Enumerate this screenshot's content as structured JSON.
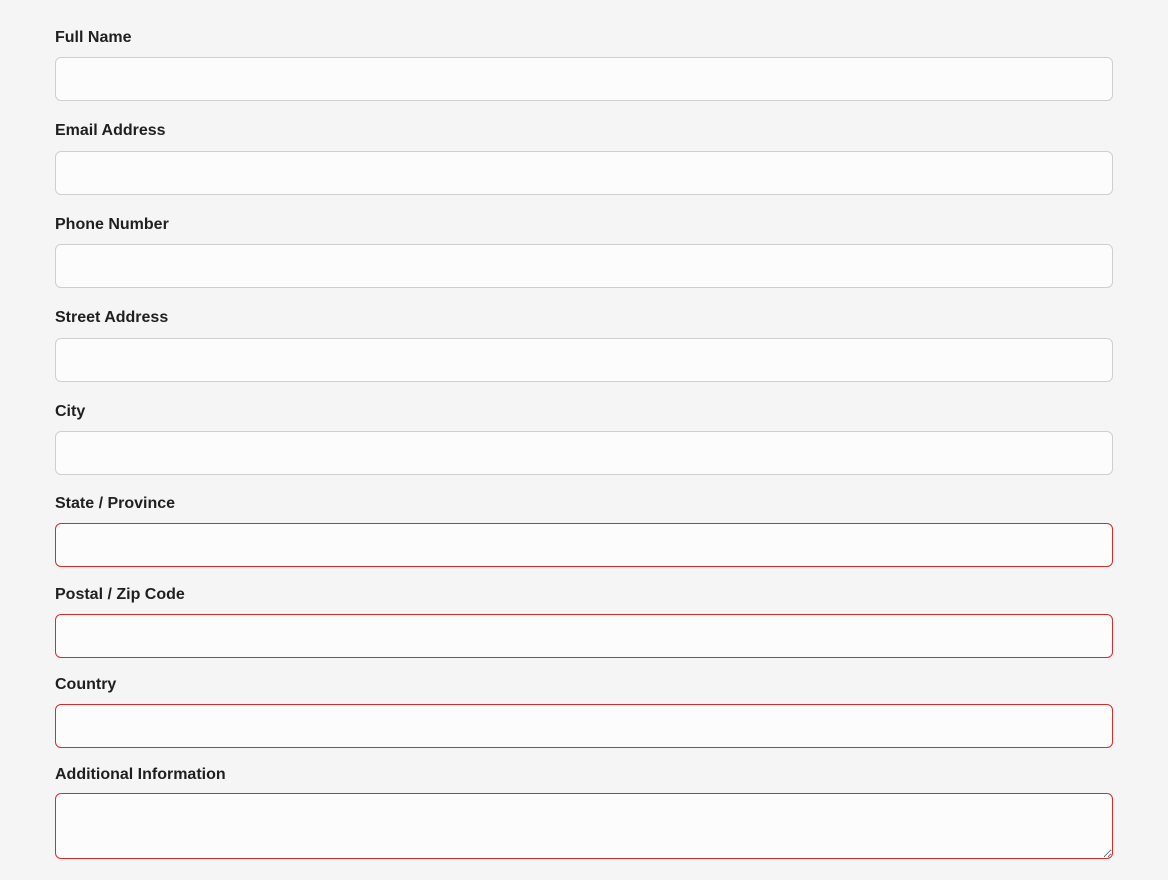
{
  "form": {
    "fields": [
      {
        "id": "full_name",
        "label": "Full Name",
        "value": "",
        "placeholder": "",
        "invalid": false
      },
      {
        "id": "email_address",
        "label": "Email Address",
        "value": "",
        "placeholder": "",
        "invalid": false
      },
      {
        "id": "phone_number",
        "label": "Phone Number",
        "value": "",
        "placeholder": "",
        "invalid": false
      },
      {
        "id": "street_address",
        "label": "Street Address",
        "value": "",
        "placeholder": "",
        "invalid": false
      },
      {
        "id": "city",
        "label": "City",
        "value": "",
        "placeholder": "",
        "invalid": false
      },
      {
        "id": "state_province",
        "label": "State / Province",
        "value": "",
        "placeholder": "",
        "invalid": true
      },
      {
        "id": "postal_zip_code",
        "label": "Postal / Zip Code",
        "value": "",
        "placeholder": "",
        "invalid": true
      },
      {
        "id": "country",
        "label": "Country",
        "value": "",
        "placeholder": "",
        "invalid": true
      },
      {
        "id": "additional_information",
        "label": "Additional Information",
        "value": "",
        "placeholder": "",
        "invalid": true
      }
    ]
  },
  "colors": {
    "background": "#f5f5f5",
    "label_text": "#1f1f1f",
    "input_border": "#cfcfcf",
    "input_border_invalid": "#d92b2b",
    "input_background": "#fcfcfc"
  }
}
